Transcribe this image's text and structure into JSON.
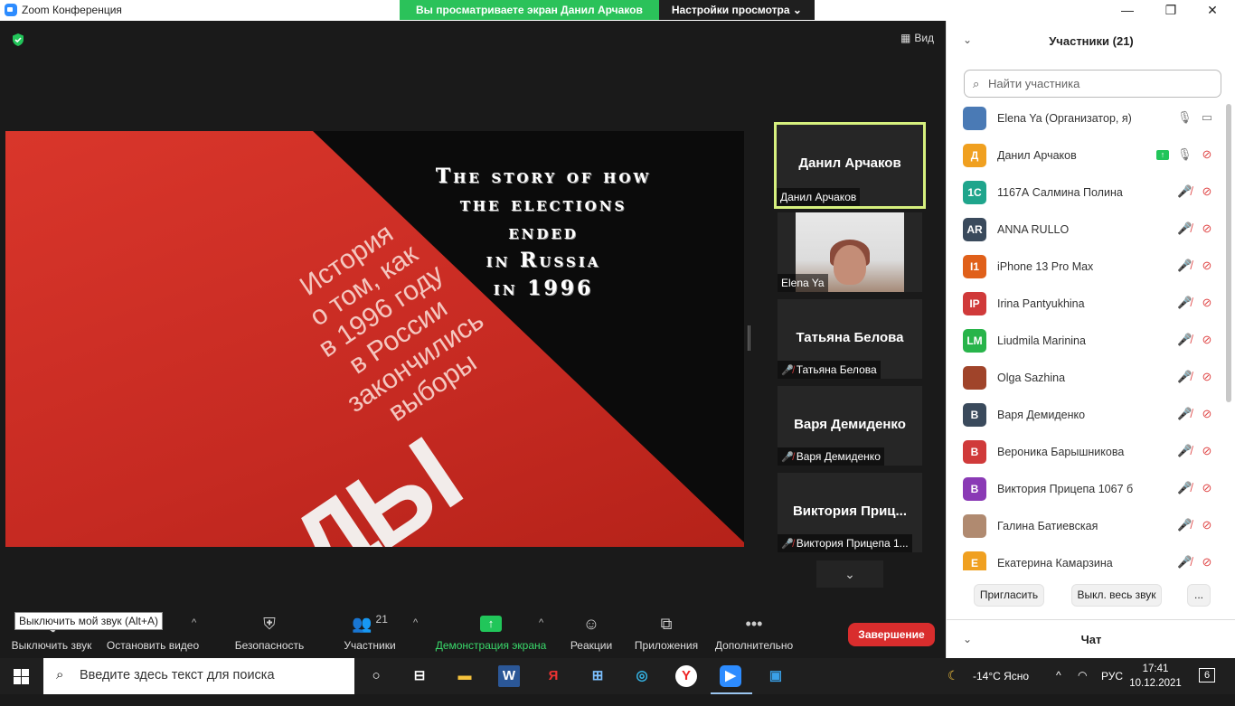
{
  "window": {
    "title": "Zoom Конференция",
    "minimize": "—",
    "maximize": "❐",
    "close": "✕"
  },
  "share_banner": {
    "status": "Вы просматриваете экран Данил Арчаков",
    "options": "Настройки просмотра"
  },
  "view_button": "Вид",
  "shared_content": {
    "english_title": [
      "The story of how",
      "the elections",
      "ended",
      "in Russia",
      "in 1996"
    ],
    "russian_title": [
      "История",
      "о том, как",
      "в 1996 году",
      "в России",
      "закончились",
      "выборы"
    ],
    "big_letters": "ДЫ"
  },
  "video_tiles": [
    {
      "name": "Данил Арчаков",
      "label": "Данил Арчаков",
      "muted": false,
      "active": true
    },
    {
      "name": "",
      "label": "Elena Ya",
      "muted": false,
      "video": true
    },
    {
      "name": "Татьяна Белова",
      "label": "Татьяна Белова",
      "muted": true
    },
    {
      "name": "Варя Демиденко",
      "label": "Варя Демиденко",
      "muted": true
    },
    {
      "name": "Виктория  Приц...",
      "label": "Виктория Прицепа 1...",
      "muted": true
    }
  ],
  "toolbar": {
    "mute": "Выключить звук",
    "video": "Остановить видео",
    "security": "Безопасность",
    "participants": "Участники",
    "participants_count": "21",
    "share": "Демонстрация экрана",
    "reactions": "Реакции",
    "apps": "Приложения",
    "more": "Дополнительно",
    "tooltip": "Выключить мой звук (Alt+A)",
    "end": "Завершение"
  },
  "participants_panel": {
    "title": "Участники (21)",
    "search_placeholder": "Найти участника",
    "participants": [
      {
        "initials": "",
        "name": "Elena Ya (Организатор, я)",
        "color": "#4a7ab5",
        "mic_muted": false,
        "cam_off": false
      },
      {
        "initials": "Д",
        "name": "Данил Арчаков",
        "color": "#f0a020",
        "mic_muted": false,
        "cam_off": true,
        "sharing": true
      },
      {
        "initials": "1C",
        "name": "1167А Салмина Полина",
        "color": "#1fa58c",
        "mic_muted": true,
        "cam_off": true
      },
      {
        "initials": "AR",
        "name": "ANNA RULLO",
        "color": "#3a4a5c",
        "mic_muted": true,
        "cam_off": true
      },
      {
        "initials": "I1",
        "name": "iPhone 13 Pro Max",
        "color": "#e0601a",
        "mic_muted": true,
        "cam_off": true
      },
      {
        "initials": "IP",
        "name": "Irina Pantyukhina",
        "color": "#d03a3a",
        "mic_muted": true,
        "cam_off": true
      },
      {
        "initials": "LM",
        "name": "Liudmila Marinina",
        "color": "#28b44a",
        "mic_muted": true,
        "cam_off": true
      },
      {
        "initials": "",
        "name": "Olga Sazhina",
        "color": "#a0442a",
        "mic_muted": true,
        "cam_off": true
      },
      {
        "initials": "В",
        "name": "Варя Демиденко",
        "color": "#3a4a5c",
        "mic_muted": true,
        "cam_off": true
      },
      {
        "initials": "В",
        "name": "Вероника Барышникова",
        "color": "#d03a3a",
        "mic_muted": true,
        "cam_off": true
      },
      {
        "initials": "В",
        "name": "Виктория Прицепа 1067 б",
        "color": "#8a3ab5",
        "mic_muted": true,
        "cam_off": true
      },
      {
        "initials": "",
        "name": "Галина Батиевская",
        "color": "#b08a70",
        "mic_muted": true,
        "cam_off": true
      },
      {
        "initials": "Е",
        "name": "Екатерина Камарзина",
        "color": "#f0a020",
        "mic_muted": true,
        "cam_off": true
      }
    ],
    "invite": "Пригласить",
    "mute_all": "Выкл. весь звук",
    "more": "...",
    "chat_title": "Чат"
  },
  "taskbar": {
    "search_placeholder": "Введите здесь текст для поиска",
    "weather": "-14°C  Ясно",
    "language": "РУС",
    "time": "17:41",
    "date": "10.12.2021",
    "notifications": "6"
  },
  "colors": {
    "accent_green": "#2bc25a",
    "end_red": "#d92d2d",
    "active_border": "#d6f07e"
  }
}
